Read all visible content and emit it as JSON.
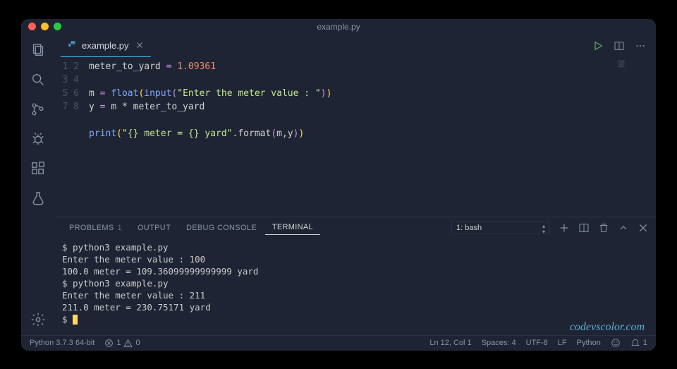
{
  "titlebar": {
    "title": "example.py"
  },
  "tab": {
    "filename": "example.py"
  },
  "code": {
    "lines": [
      "1",
      "2",
      "3",
      "4",
      "5",
      "6",
      "7",
      "8"
    ],
    "l1_var": "meter_to_yard",
    "l1_eq": " = ",
    "l1_val": "1.09361",
    "l3_a": "m",
    "l3_eq": " = ",
    "l3_float": "float",
    "l3_input": "input",
    "l3_str": "\"Enter the meter value : \"",
    "l4_a": "y",
    "l4_eq": " = ",
    "l4_expr": "m * meter_to_yard",
    "l6_print": "print",
    "l6_str": "\"{} meter = {} yard\"",
    "l6_format": ".format",
    "l6_args": "m,y"
  },
  "panel": {
    "tabs": {
      "problems": "PROBLEMS",
      "problems_badge": "1",
      "output": "OUTPUT",
      "debug": "DEBUG CONSOLE",
      "terminal": "TERMINAL"
    },
    "select": "1: bash"
  },
  "terminal": {
    "lines": [
      "$ python3 example.py",
      "Enter the meter value : 100",
      "100.0 meter = 109.36099999999999 yard",
      "$ python3 example.py",
      "Enter the meter value : 211",
      "211.0 meter = 230.75171 yard",
      "$ "
    ]
  },
  "statusbar": {
    "python": "Python 3.7.3 64-bit",
    "errors": "1",
    "warnings": "0",
    "ln_col": "Ln 12, Col 1",
    "spaces": "Spaces: 4",
    "encoding": "UTF-8",
    "eol": "LF",
    "lang": "Python",
    "bell": "1"
  },
  "watermark": "codevscolor.com"
}
